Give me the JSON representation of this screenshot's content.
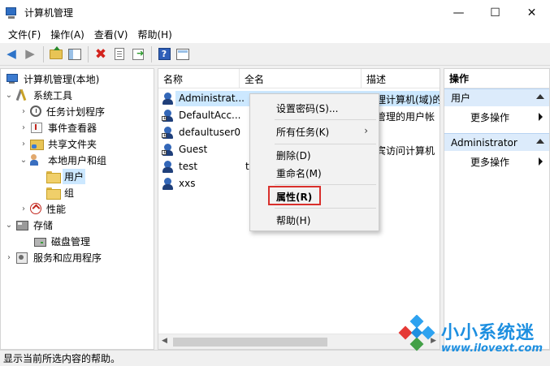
{
  "window": {
    "title": "计算机管理",
    "controls": {
      "minimize": "—",
      "maximize": "☐",
      "close": "✕"
    }
  },
  "menubar": {
    "items": [
      "文件(F)",
      "操作(A)",
      "查看(V)",
      "帮助(H)"
    ]
  },
  "toolbar": {
    "icons": [
      "back-icon",
      "forward-icon",
      "up-folder-icon",
      "show-hide-tree-icon",
      "delete-icon",
      "properties-icon",
      "export-icon",
      "help-icon",
      "view-icon"
    ]
  },
  "tree": {
    "items": [
      {
        "label": "计算机管理(本地)",
        "toggle": ""
      },
      {
        "label": "系统工具",
        "toggle": "⌄"
      },
      {
        "label": "任务计划程序",
        "toggle": "›"
      },
      {
        "label": "事件查看器",
        "toggle": "›"
      },
      {
        "label": "共享文件夹",
        "toggle": "›"
      },
      {
        "label": "本地用户和组",
        "toggle": "⌄"
      },
      {
        "label": "用户",
        "toggle": ""
      },
      {
        "label": "组",
        "toggle": ""
      },
      {
        "label": "性能",
        "toggle": "›"
      },
      {
        "label": "存储",
        "toggle": "⌄"
      },
      {
        "label": "磁盘管理",
        "toggle": ""
      },
      {
        "label": "服务和应用程序",
        "toggle": "›"
      }
    ]
  },
  "list": {
    "columns": [
      "名称",
      "全名",
      "描述"
    ],
    "rows": [
      {
        "name": "Administrat...",
        "fullname": "",
        "desc": "管理计算机(域)的"
      },
      {
        "name": "DefaultAcc...",
        "fullname": "",
        "desc": "统管理的用户帐"
      },
      {
        "name": "defaultuser0",
        "fullname": "",
        "desc": ""
      },
      {
        "name": "Guest",
        "fullname": "",
        "desc": "来宾访问计算机"
      },
      {
        "name": "test",
        "fullname": "t",
        "desc": ""
      },
      {
        "name": "xxs",
        "fullname": "",
        "desc": ""
      }
    ],
    "scroll_left": "◀",
    "scroll_right": "▶"
  },
  "context_menu": {
    "items": [
      "设置密码(S)...",
      "所有任务(K)",
      "删除(D)",
      "重命名(M)",
      "属性(R)",
      "帮助(H)"
    ],
    "submenu_arrow": "›"
  },
  "actions": {
    "title": "操作",
    "sections": [
      {
        "label": "用户",
        "item": "更多操作"
      },
      {
        "label": "Administrator",
        "item": "更多操作"
      }
    ]
  },
  "statusbar": {
    "text": "显示当前所选内容的帮助。"
  },
  "watermark": {
    "title": "小小系统迷",
    "url": "www.ilovext.com"
  },
  "colors": {
    "selection": "#cce8ff",
    "accent_blue": "#1d8fe0",
    "highlight_red": "#d9302c",
    "section_bg": "#dcebfb"
  }
}
